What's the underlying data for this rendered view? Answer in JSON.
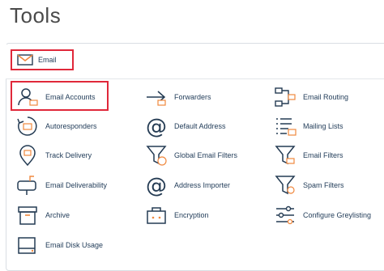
{
  "page": {
    "title": "Tools"
  },
  "section": {
    "label": "Email"
  },
  "tools": [
    {
      "label": "Email Accounts",
      "icon": "email-accounts-icon"
    },
    {
      "label": "Forwarders",
      "icon": "forwarders-icon"
    },
    {
      "label": "Email Routing",
      "icon": "email-routing-icon"
    },
    {
      "label": "Autoresponders",
      "icon": "autoresponders-icon"
    },
    {
      "label": "Default Address",
      "icon": "default-address-icon"
    },
    {
      "label": "Mailing Lists",
      "icon": "mailing-lists-icon"
    },
    {
      "label": "Track Delivery",
      "icon": "track-delivery-icon"
    },
    {
      "label": "Global Email Filters",
      "icon": "global-email-filters-icon"
    },
    {
      "label": "Email Filters",
      "icon": "email-filters-icon"
    },
    {
      "label": "Email Deliverability",
      "icon": "email-deliverability-icon"
    },
    {
      "label": "Address Importer",
      "icon": "address-importer-icon"
    },
    {
      "label": "Spam Filters",
      "icon": "spam-filters-icon"
    },
    {
      "label": "Archive",
      "icon": "archive-icon"
    },
    {
      "label": "Encryption",
      "icon": "encryption-icon"
    },
    {
      "label": "Configure Greylisting",
      "icon": "configure-greylisting-icon"
    },
    {
      "label": "Email Disk Usage",
      "icon": "email-disk-usage-icon"
    }
  ],
  "colors": {
    "highlight": "#e0283a",
    "accent": "#f0883e",
    "icon": "#243b53",
    "watermark": "#cfe3f3"
  }
}
